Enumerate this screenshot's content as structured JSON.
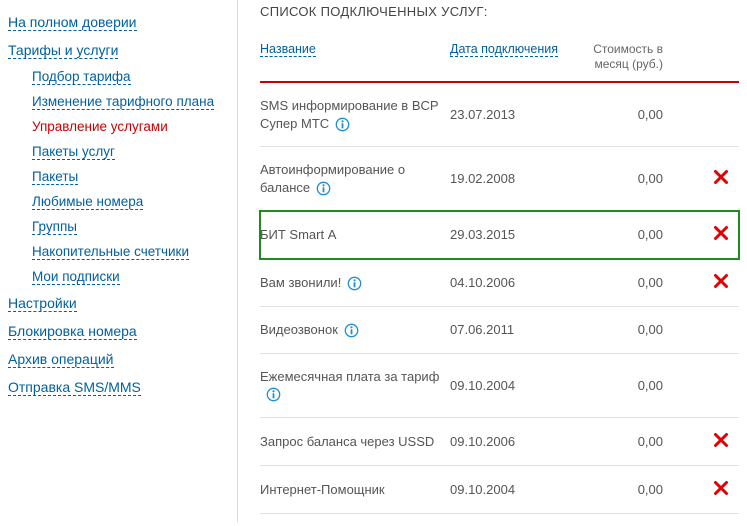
{
  "sidebar": {
    "top0": "На полном доверии",
    "top1": "Тарифы и услуги",
    "sub": {
      "s0": "Подбор тарифа",
      "s1": "Изменение тарифного плана",
      "s2": "Управление услугами",
      "s3": "Пакеты услуг",
      "s4": "Пакеты",
      "s5": "Любимые номера",
      "s6": "Группы",
      "s7": "Накопительные счетчики",
      "s8": "Мои подписки"
    },
    "top2": "Настройки",
    "top3": "Блокировка номера",
    "top4": "Архив операций",
    "top5": "Отправка SMS/MMS"
  },
  "main": {
    "title": "СПИСОК ПОДКЛЮЧЕННЫХ УСЛУГ:",
    "head": {
      "name": "Название",
      "date": "Дата подключения",
      "cost": "Стоимость в месяц (руб.)"
    },
    "rows": [
      {
        "name": "SMS информирование в BCP Супер МТС",
        "date": "23.07.2013",
        "cost": "0,00",
        "info": true,
        "remove": false,
        "hl": false
      },
      {
        "name": "Автоинформирование о балансе",
        "date": "19.02.2008",
        "cost": "0,00",
        "info": true,
        "remove": true,
        "hl": false
      },
      {
        "name": "БИТ Smart А",
        "date": "29.03.2015",
        "cost": "0,00",
        "info": false,
        "remove": true,
        "hl": true
      },
      {
        "name": "Вам звонили!",
        "date": "04.10.2006",
        "cost": "0,00",
        "info": true,
        "remove": true,
        "hl": false
      },
      {
        "name": "Видеозвонок",
        "date": "07.06.2011",
        "cost": "0,00",
        "info": true,
        "remove": false,
        "hl": false
      },
      {
        "name": "Ежемесячная плата за тариф",
        "date": "09.10.2004",
        "cost": "0,00",
        "info": true,
        "remove": false,
        "hl": false
      },
      {
        "name": "Запрос баланса через USSD",
        "date": "09.10.2006",
        "cost": "0,00",
        "info": false,
        "remove": true,
        "hl": false
      },
      {
        "name": "Интернет-Помощник",
        "date": "09.10.2004",
        "cost": "0,00",
        "info": false,
        "remove": true,
        "hl": false
      }
    ]
  }
}
